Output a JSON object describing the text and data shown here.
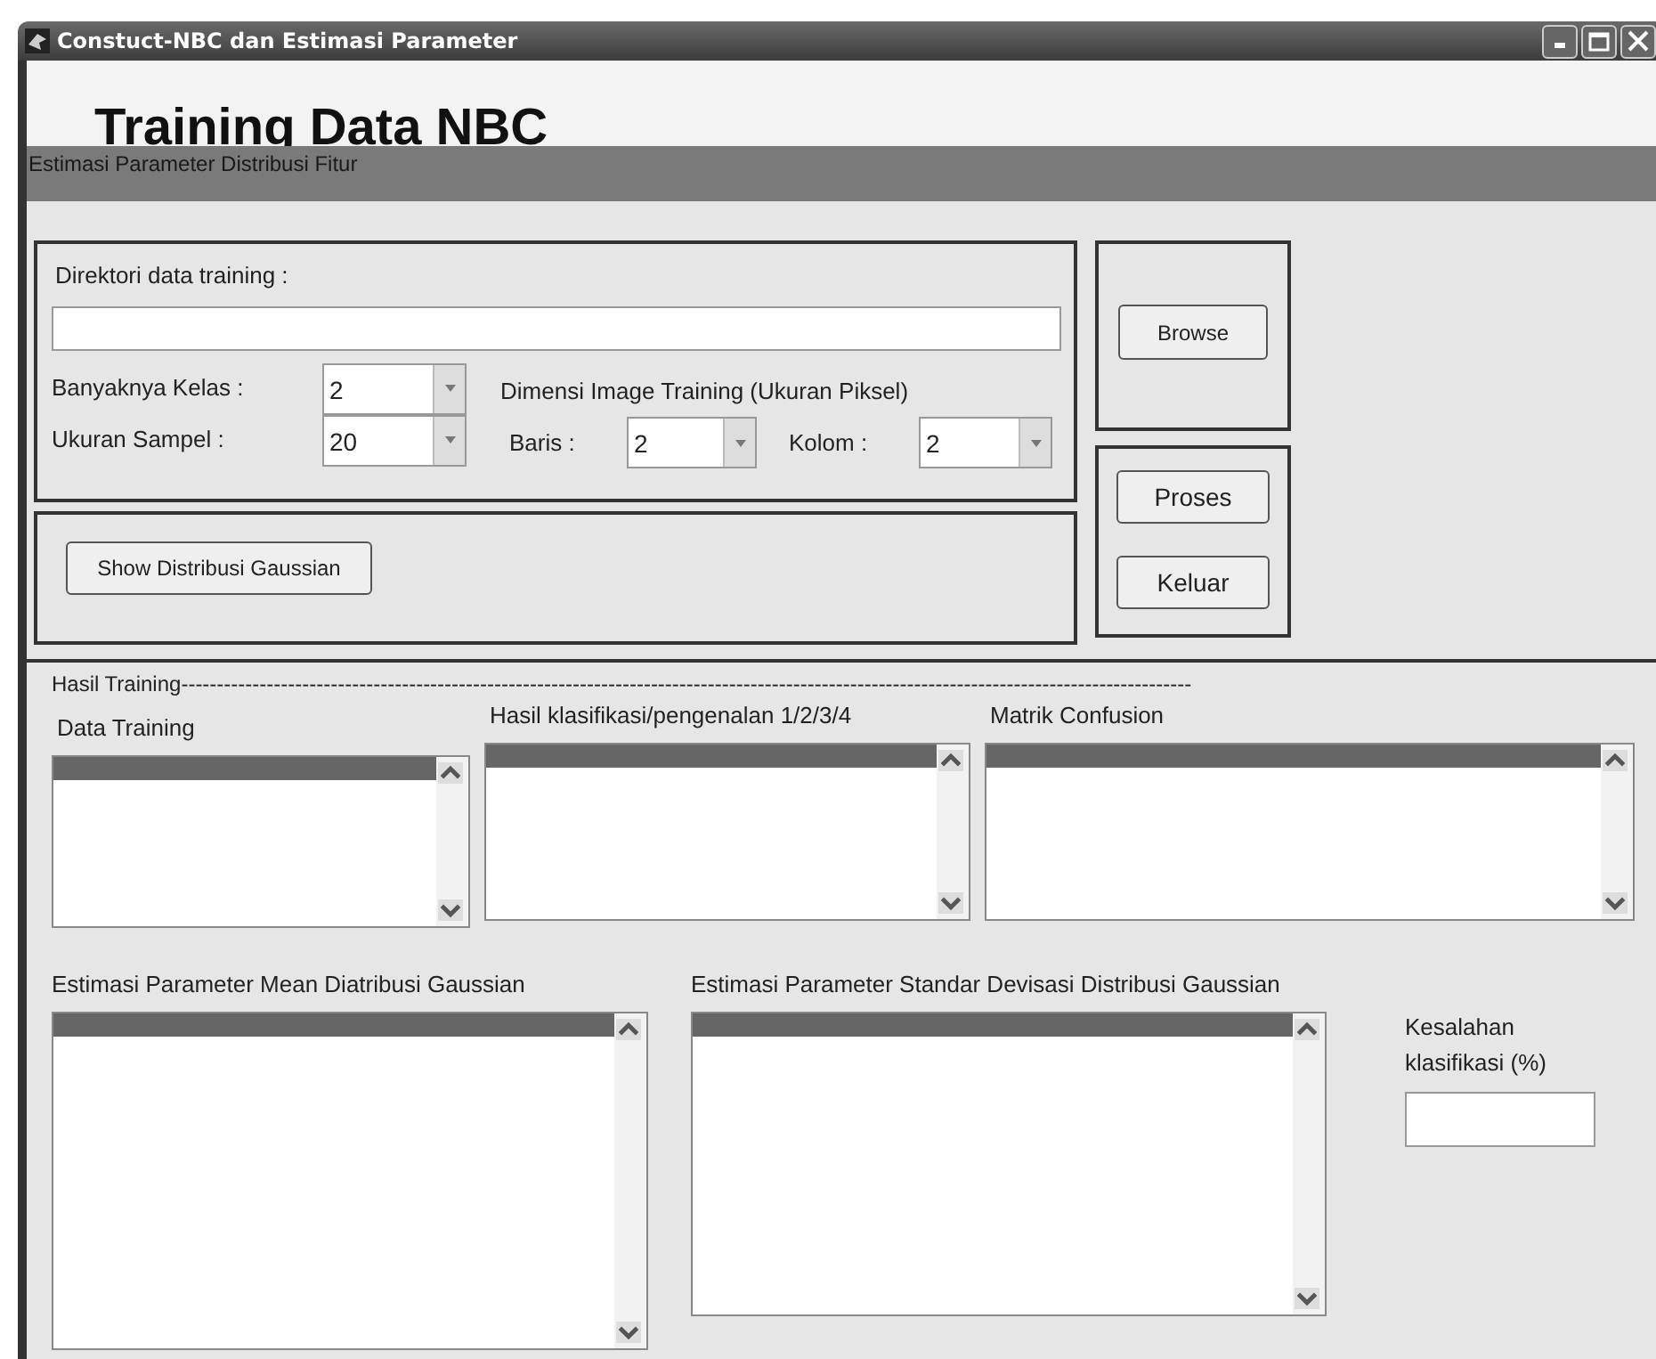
{
  "window": {
    "title": "Constuct-NBC dan Estimasi Parameter"
  },
  "heading": "Training Data NBC",
  "section_title": "Estimasi Parameter Distribusi Fitur",
  "directory": {
    "label": "Direktori data training :"
  },
  "class_count": {
    "label": "Banyaknya Kelas :",
    "value": "2"
  },
  "sample_size": {
    "label": "Ukuran Sampel :",
    "value": "20"
  },
  "image_dimension": {
    "label": "Dimensi Image Training (Ukuran Piksel)",
    "rows": {
      "label": "Baris :",
      "value": "2"
    },
    "columns": {
      "label": "Kolom :",
      "value": "2"
    }
  },
  "show_button": "Show Distribusi Gaussian",
  "browse_button": "Browse",
  "action_buttons": [
    "Proses",
    "Keluar"
  ],
  "results": {
    "title": "Hasil Training----------------------------------------------------------------------------------------------------------------------------------------------",
    "lists_top": [
      {
        "label": "Data Training",
        "first_row_selected": true
      },
      {
        "label": "Hasil klasifikasi/pengenalan 1/2/3/4",
        "first_row_selected": true
      },
      {
        "label": "Matrik Confusion",
        "first_row_selected": true
      }
    ],
    "lists_bottom": [
      {
        "label": "Estimasi Parameter Mean Diatribusi Gaussian",
        "first_row_selected": true
      },
      {
        "label": "Estimasi Parameter Standar Devisasi  Distribusi Gaussian",
        "first_row_selected": true
      }
    ],
    "error": {
      "label": "Kesalahan klasifikasi (%)"
    }
  }
}
